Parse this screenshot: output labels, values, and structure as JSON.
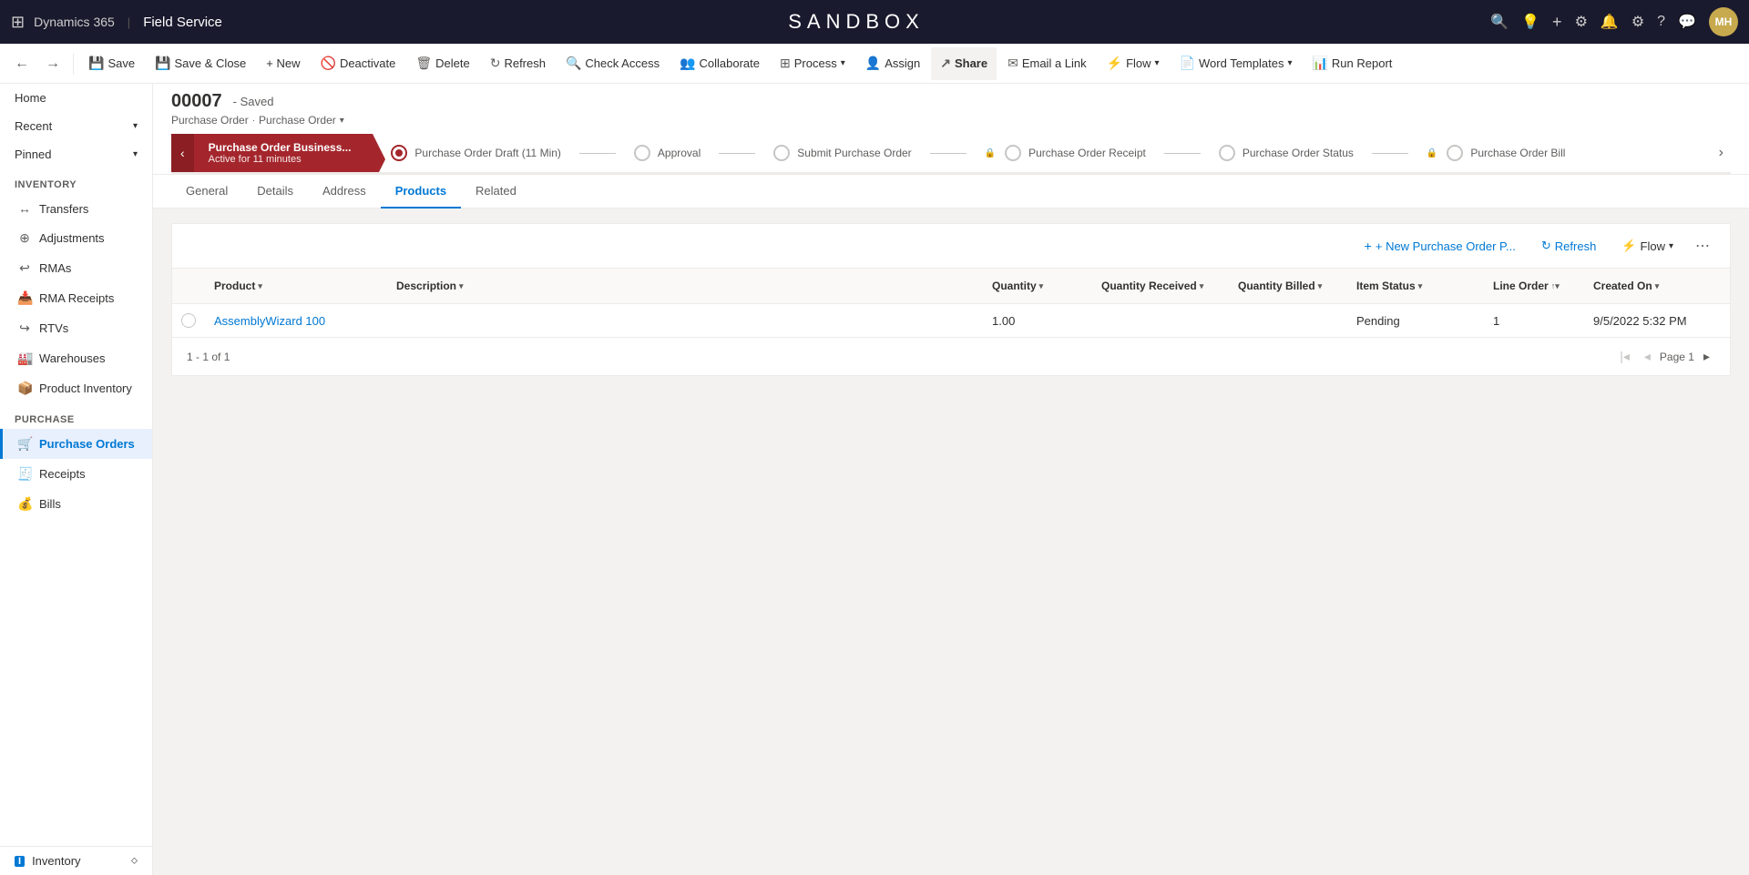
{
  "app": {
    "brand": "Dynamics 365",
    "separator": "|",
    "app_name": "Field Service",
    "sandbox_title": "SANDBOX"
  },
  "top_nav_icons": [
    "search",
    "lightbulb",
    "plus",
    "filter",
    "bell",
    "settings",
    "help",
    "chat"
  ],
  "avatar": {
    "initials": "MH"
  },
  "cmd_bar": {
    "back_btn": "←",
    "forward_btn": "→",
    "save": "Save",
    "save_close": "Save & Close",
    "new": "+ New",
    "deactivate": "Deactivate",
    "delete": "Delete",
    "refresh": "Refresh",
    "check_access": "Check Access",
    "collaborate": "Collaborate",
    "process": "Process",
    "assign": "Assign",
    "share": "Share",
    "email_link": "Email a Link",
    "flow": "Flow",
    "word_templates": "Word Templates",
    "run_report": "Run Report"
  },
  "record": {
    "id": "00007",
    "status": "- Saved",
    "breadcrumb1": "Purchase Order",
    "breadcrumb_sep": "·",
    "breadcrumb2": "Purchase Order"
  },
  "process_bar": {
    "active_stage": "Purchase Order Business...",
    "active_sublabel": "Active for 11 minutes",
    "stages": [
      {
        "label": "Purchase Order Draft  (11 Min)",
        "active": true,
        "locked": false
      },
      {
        "label": "Approval",
        "active": false,
        "locked": false
      },
      {
        "label": "Submit Purchase Order",
        "active": false,
        "locked": false
      },
      {
        "label": "Purchase Order Receipt",
        "active": false,
        "locked": true
      },
      {
        "label": "Purchase Order Status",
        "active": false,
        "locked": false
      },
      {
        "label": "Purchase Order Bill",
        "active": false,
        "locked": true
      }
    ]
  },
  "tabs": [
    {
      "label": "General",
      "active": false
    },
    {
      "label": "Details",
      "active": false
    },
    {
      "label": "Address",
      "active": false
    },
    {
      "label": "Products",
      "active": true
    },
    {
      "label": "Related",
      "active": false
    }
  ],
  "products_grid": {
    "new_btn": "+ New Purchase Order P...",
    "refresh_btn": "Refresh",
    "flow_btn": "Flow",
    "more_btn": "⋯",
    "columns": [
      {
        "label": "",
        "sortable": false
      },
      {
        "label": "Product",
        "sortable": true
      },
      {
        "label": "Description",
        "sortable": true
      },
      {
        "label": "Quantity",
        "sortable": true
      },
      {
        "label": "Quantity Received",
        "sortable": true
      },
      {
        "label": "Quantity Billed",
        "sortable": true
      },
      {
        "label": "Item Status",
        "sortable": true
      },
      {
        "label": "Line Order",
        "sortable": true
      },
      {
        "label": "Created On",
        "sortable": true
      }
    ],
    "rows": [
      {
        "product": "AssemblyWizard 100",
        "description": "",
        "quantity": "1.00",
        "quantity_received": "",
        "quantity_billed": "",
        "item_status": "Pending",
        "line_order": "1",
        "created_on": "9/5/2022 5:32 PM"
      }
    ],
    "footer": {
      "count_text": "1 - 1 of 1",
      "page_label": "Page 1"
    }
  },
  "sidebar": {
    "nav_group_home": "Home",
    "nav_group_recent": "Recent",
    "nav_group_pinned": "Pinned",
    "inventory_section": "Inventory",
    "inventory_items": [
      {
        "label": "Transfers",
        "icon": "↔"
      },
      {
        "label": "Adjustments",
        "icon": "⊕"
      },
      {
        "label": "RMAs",
        "icon": "↩"
      },
      {
        "label": "RMA Receipts",
        "icon": "📥"
      },
      {
        "label": "RTVs",
        "icon": "↪"
      },
      {
        "label": "Warehouses",
        "icon": "🏭"
      },
      {
        "label": "Product Inventory",
        "icon": "📦"
      }
    ],
    "purchase_section": "Purchase",
    "purchase_items": [
      {
        "label": "Purchase Orders",
        "icon": "🛒",
        "active": true
      },
      {
        "label": "Receipts",
        "icon": "🧾"
      },
      {
        "label": "Bills",
        "icon": "💰"
      }
    ],
    "bottom_label": "Inventory",
    "bottom_badge": "I"
  }
}
